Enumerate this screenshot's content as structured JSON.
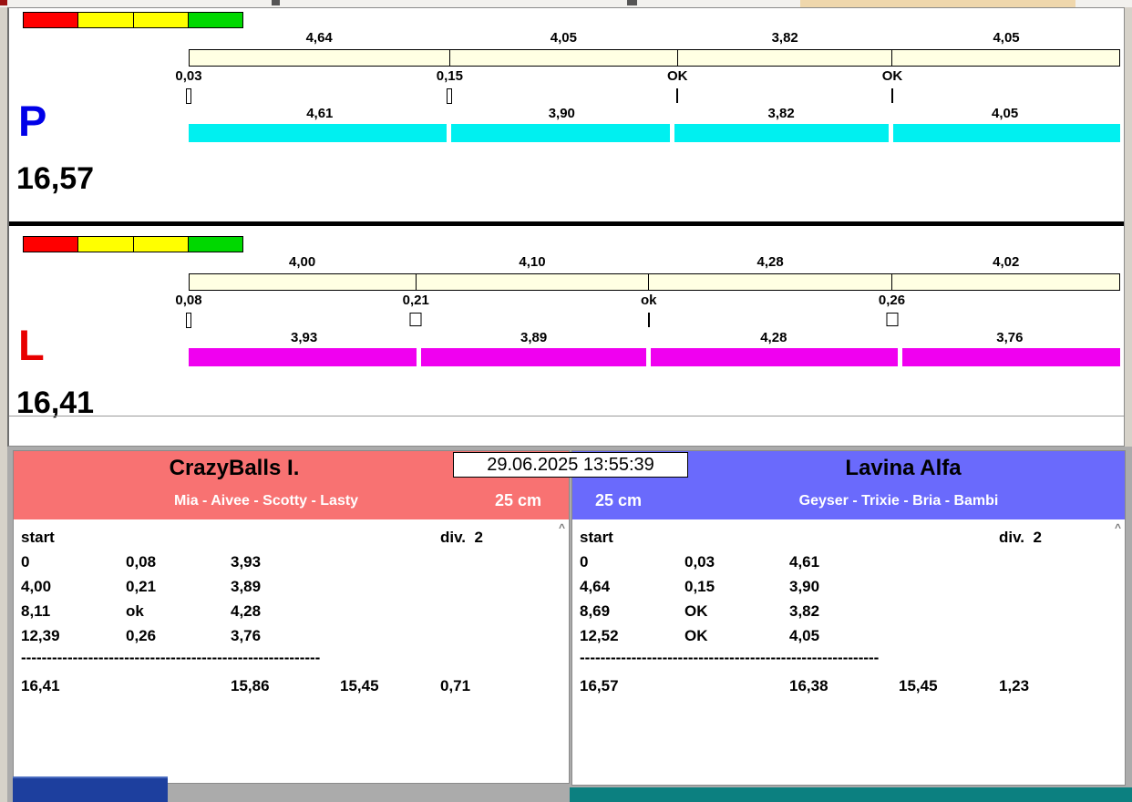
{
  "datetime": "29.06.2025 13:55:39",
  "colors": {
    "p_bar": "#00f0f0",
    "l_bar": "#f000f0",
    "p_letter": "#0000e8",
    "l_letter": "#e80000",
    "plan_bar": "#ffffe3",
    "team_left_header": "#f87272",
    "team_right_header": "#6a6afc",
    "traffic": [
      "#ff0000",
      "#ffff00",
      "#ffff00",
      "#00d800"
    ]
  },
  "lanes": [
    {
      "letter": "P",
      "total": "16,57",
      "plan_times": [
        "4,64",
        "4,05",
        "3,82",
        "4,05"
      ],
      "marks": [
        "0,03",
        "0,15",
        "OK",
        "OK"
      ],
      "run_times": [
        "4,61",
        "3,90",
        "3,82",
        "4,05"
      ]
    },
    {
      "letter": "L",
      "total": "16,41",
      "plan_times": [
        "4,00",
        "4,10",
        "4,28",
        "4,02"
      ],
      "marks": [
        "0,08",
        "0,21",
        "ok",
        "0,26"
      ],
      "run_times": [
        "3,93",
        "3,89",
        "4,28",
        "3,76"
      ]
    }
  ],
  "teams": [
    {
      "name": "CrazyBalls I.",
      "members": "Mia - Aivee - Scotty - Lasty",
      "height": "25 cm",
      "start_label": "start",
      "div_label": "div.  2",
      "rows": [
        [
          "0",
          "0,08",
          "3,93"
        ],
        [
          "4,00",
          "0,21",
          "3,89"
        ],
        [
          "8,11",
          "ok",
          "4,28"
        ],
        [
          "12,39",
          "0,26",
          "3,76"
        ]
      ],
      "separator": "----------------------------------------------------------",
      "totals": [
        "16,41",
        "15,86",
        "15,45",
        "0,71"
      ],
      "scroll_icon": "^"
    },
    {
      "name": "Lavina Alfa",
      "members": "Geyser - Trixie - Bria - Bambi",
      "height": "25 cm",
      "start_label": "start",
      "div_label": "div.  2",
      "rows": [
        [
          "0",
          "0,03",
          "4,61"
        ],
        [
          "4,64",
          "0,15",
          "3,90"
        ],
        [
          "8,69",
          "OK",
          "3,82"
        ],
        [
          "12,52",
          "OK",
          "4,05"
        ]
      ],
      "separator": "----------------------------------------------------------",
      "totals": [
        "16,57",
        "16,38",
        "15,45",
        "1,23"
      ],
      "scroll_icon": "^"
    }
  ]
}
